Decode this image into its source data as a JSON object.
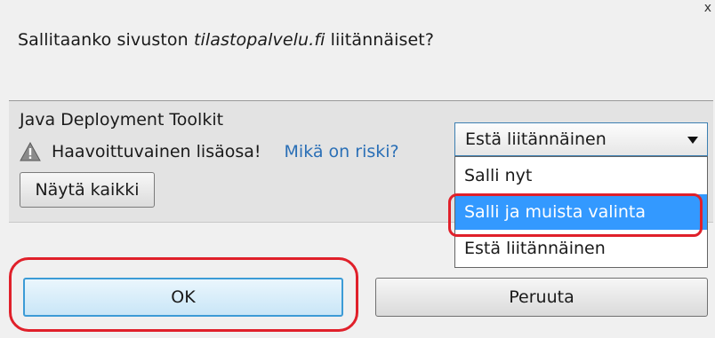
{
  "dialog": {
    "close_label": "x",
    "question_before": "Sallitaanko sivuston ",
    "question_site": "tilastopalvelu.fi",
    "question_after": " liitännäiset?"
  },
  "plugin": {
    "name": "Java Deployment Toolkit",
    "warning": "Haavoittuvainen lisäosa!",
    "risk_link": "Mikä on riski?",
    "show_all": "Näytä kaikki",
    "selected": "Estä liitännäinen",
    "options": [
      "Salli nyt",
      "Salli ja muista valinta",
      "Estä liitännäinen"
    ]
  },
  "buttons": {
    "ok": "OK",
    "cancel": "Peruuta"
  },
  "colors": {
    "highlight_ring": "#e0202a",
    "link": "#2a6fb6",
    "selection": "#3399ff"
  },
  "icons": {
    "warning": "warning-triangle-icon",
    "dropdown": "chevron-down-icon"
  }
}
